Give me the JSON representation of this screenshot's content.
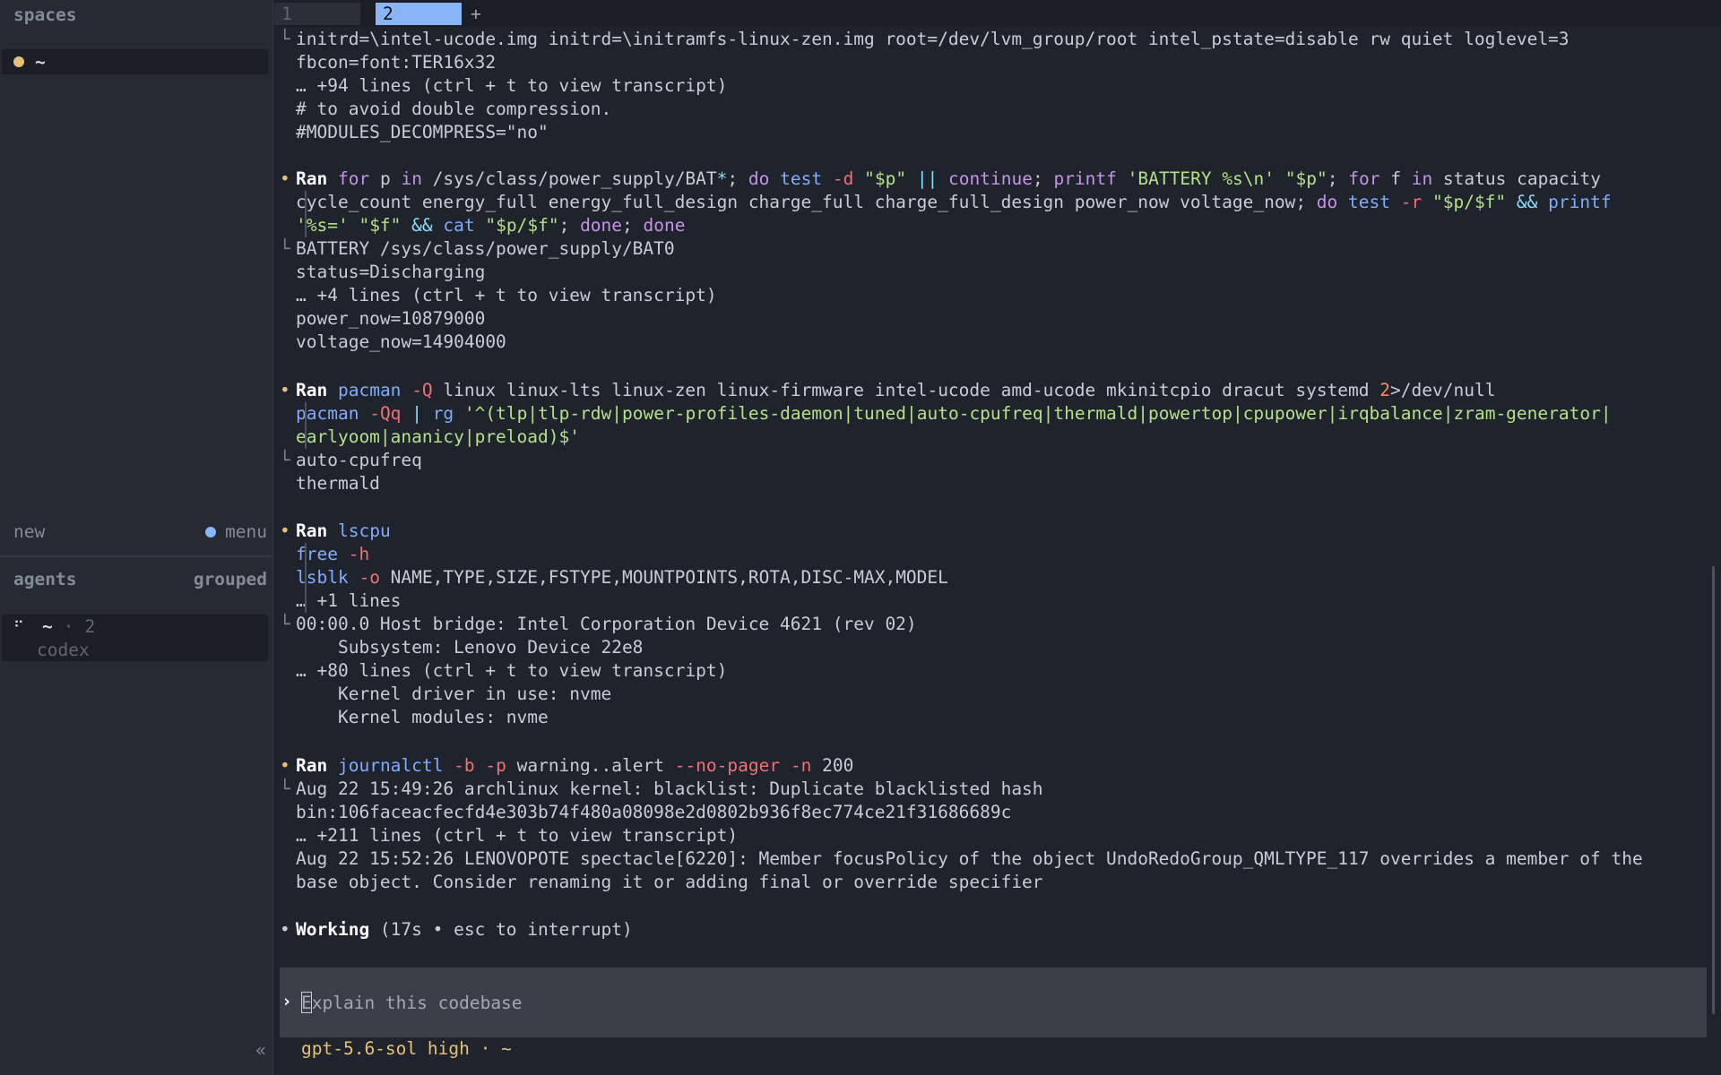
{
  "sidebar": {
    "spaces_title": "spaces",
    "spaces": [
      {
        "name": "~",
        "dot_color": "#e6c07b"
      }
    ],
    "new_label": "new",
    "menu_label": "menu",
    "menu_dot_color": "#8ab4f8",
    "agents_title": "agents",
    "grouped_label": "grouped",
    "agent": {
      "space": "~",
      "separator": "·",
      "count": "2",
      "kind": "codex"
    },
    "collapse_glyph": "«"
  },
  "tabs": [
    {
      "label": "1"
    },
    {
      "label": "2"
    }
  ],
  "tab_add": "+",
  "terminal": {
    "prev": {
      "l1": "initrd=\\intel-ucode.img initrd=\\initramfs-linux-zen.img root=/dev/lvm_group/root intel_pstate=disable rw quiet loglevel=3",
      "l2": "fbcon=font:TER16x32",
      "l3": "… +94 lines (ctrl + t to view transcript)",
      "l4": "# to avoid double compression.",
      "l5": "#MODULES_DECOMPRESS=\"no\""
    },
    "ran_label": "Ran",
    "bullet": "•",
    "corner": "└",
    "b1": {
      "c1": "for",
      "c2": " p ",
      "c3": "in",
      "c4": " /sys/class/power_supply/BAT",
      "c5": "*",
      "c6": "; ",
      "c7": "do",
      "c8": " ",
      "c9": "test",
      "c10": " ",
      "c11": "-d",
      "c12": " ",
      "c13": "\"$p\"",
      "c14": " ",
      "c15": "||",
      "c16": " ",
      "c17": "continue",
      "c18": "; ",
      "c19": "printf",
      "c20": " ",
      "c21": "'BATTERY %s\\n'",
      "c22": " ",
      "c23": "\"$p\"",
      "c24": "; ",
      "c25": "for",
      "c26": " f ",
      "c27": "in",
      "c28": " status capacity",
      "d1": "cycle_count energy_full energy_full_design charge_full charge_full_design power_now voltage_now",
      "d2": "; ",
      "d3": "do",
      "d4": " ",
      "d5": "test",
      "d6": " ",
      "d7": "-r",
      "d8": " ",
      "d9": "\"$p/$f\"",
      "d10": " ",
      "d11": "&&",
      "d12": " ",
      "d13": "printf",
      "e1": "'%s='",
      "e2": " ",
      "e3": "\"$f\"",
      "e4": " ",
      "e5": "&&",
      "e6": " ",
      "e7": "cat",
      "e8": " ",
      "e9": "\"$p/$f\"",
      "e10": "; ",
      "e11": "done",
      "e12": "; ",
      "e13": "done",
      "o1": "BATTERY /sys/class/power_supply/BAT0",
      "o2": "status=Discharging",
      "o3": "… +4 lines (ctrl + t to view transcript)",
      "o4": "power_now=10879000",
      "o5": "voltage_now=14904000"
    },
    "b2": {
      "c1": "pacman",
      "c2": " ",
      "c3": "-Q",
      "c4": " linux linux-lts linux-zen linux-firmware intel-ucode amd-ucode mkinitcpio dracut systemd ",
      "c5": "2",
      "c6": ">/dev/null",
      "d1": "pacman",
      "d2": " ",
      "d3": "-Qq",
      "d4": " ",
      "d5": "|",
      "d6": " ",
      "d7": "rg",
      "d8": " ",
      "d9": "'^(tlp|tlp-rdw|power-profiles-daemon|tuned|auto-cpufreq|thermald|powertop|cpupower|irqbalance|zram-generator|",
      "e1": "earlyoom|ananicy|preload)$'",
      "o1": "auto-cpufreq",
      "o2": "thermald"
    },
    "b3": {
      "c1": "lscpu",
      "d1": "free",
      "d2": " ",
      "d3": "-h",
      "e1": "lsblk",
      "e2": " ",
      "e3": "-o",
      "e4": " NAME,TYPE,SIZE,FSTYPE,MOUNTPOINTS,ROTA,DISC-MAX,MODEL",
      "f1": "… +1 lines",
      "o1": "00:00.0 Host bridge: Intel Corporation Device 4621 (rev 02)",
      "o2": "    Subsystem: Lenovo Device 22e8",
      "o3": "… +80 lines (ctrl + t to view transcript)",
      "o4": "    Kernel driver in use: nvme",
      "o5": "    Kernel modules: nvme"
    },
    "b4": {
      "c1": "journalctl",
      "c2": " ",
      "c3": "-b",
      "c4": " ",
      "c5": "-p",
      "c6": " warning..alert ",
      "c7": "--no-pager",
      "c8": " ",
      "c9": "-n",
      "c10": " 200",
      "o1": "Aug 22 15:49:26 archlinux kernel: blacklist: Duplicate blacklisted hash",
      "o2": "bin:106faceacfecfd4e303b74f480a08098e2d0802b936f8ec774ce21f31686689c",
      "o3": "… +211 lines (ctrl + t to view transcript)",
      "o4": "Aug 22 15:52:26 LENOVOPOTE spectacle[6220]: Member focusPolicy of the object UndoRedoGroup_QMLTYPE_117 overrides a member of the",
      "o5": "base object. Consider renaming it or adding final or override specifier"
    },
    "working": {
      "label": "Working",
      "detail": " (17s • esc to interrupt)"
    }
  },
  "prompt": {
    "chevron": "›",
    "placeholder": "Explain this codebase"
  },
  "status": {
    "model": "gpt-5.6-sol high · ~"
  }
}
